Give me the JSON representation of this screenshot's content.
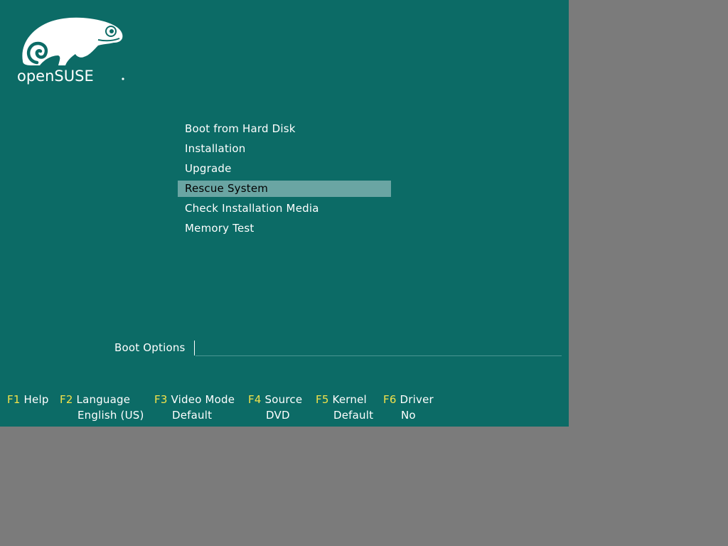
{
  "colors": {
    "screen_background": "#0c6b66",
    "outer_background": "#7b7b7b",
    "selected_item_background": "#6aa5a3",
    "function_key": "#f2e24a",
    "text": "#ffffff"
  },
  "logo": {
    "text": "openSUSE",
    "icon": "chameleon-icon"
  },
  "menu": {
    "items": [
      {
        "label": "Boot from Hard Disk",
        "selected": false
      },
      {
        "label": "Installation",
        "selected": false
      },
      {
        "label": "Upgrade",
        "selected": false
      },
      {
        "label": "Rescue System",
        "selected": true
      },
      {
        "label": "Check Installation Media",
        "selected": false
      },
      {
        "label": "Memory Test",
        "selected": false
      }
    ]
  },
  "boot_options": {
    "label": "Boot Options",
    "value": ""
  },
  "function_keys": [
    {
      "key": "F1",
      "label": "Help",
      "value": ""
    },
    {
      "key": "F2",
      "label": "Language",
      "value": "English (US)"
    },
    {
      "key": "F3",
      "label": "Video Mode",
      "value": "Default"
    },
    {
      "key": "F4",
      "label": "Source",
      "value": "DVD"
    },
    {
      "key": "F5",
      "label": "Kernel",
      "value": "Default"
    },
    {
      "key": "F6",
      "label": "Driver",
      "value": "No"
    }
  ]
}
